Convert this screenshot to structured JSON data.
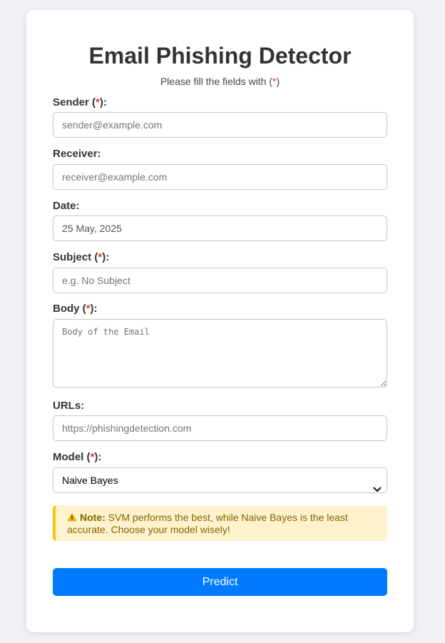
{
  "header": {
    "title": "Email Phishing Detector",
    "subtitle_prefix": "Please fill the fields with (",
    "required_mark": "*",
    "subtitle_suffix": ")"
  },
  "form": {
    "sender": {
      "label": "Sender",
      "required": true,
      "placeholder": "sender@example.com",
      "value": ""
    },
    "receiver": {
      "label": "Receiver:",
      "required": false,
      "placeholder": "receiver@example.com",
      "value": ""
    },
    "date": {
      "label": "Date:",
      "required": false,
      "placeholder": "",
      "value": "25 May, 2025"
    },
    "subject": {
      "label": "Subject",
      "required": true,
      "placeholder": "e.g. No Subject",
      "value": ""
    },
    "body": {
      "label": "Body",
      "required": true,
      "placeholder": "Body of the Email",
      "value": ""
    },
    "urls": {
      "label": "URLs:",
      "required": false,
      "placeholder": "https://phishingdetection.com",
      "value": ""
    },
    "model": {
      "label": "Model",
      "required": true,
      "selected": "Naive Bayes"
    },
    "label_open": " (",
    "label_close": "):"
  },
  "note": {
    "icon": "warning-icon",
    "heading": "Note:",
    "text": " SVM performs the best, while Naive Bayes is the least accurate. Choose your model wisely!"
  },
  "actions": {
    "predict_label": "Predict"
  },
  "colors": {
    "primary": "#007bff",
    "required": "#e53935",
    "note_bg": "#fff3cd",
    "note_border": "#ffc107",
    "note_text": "#856404"
  }
}
